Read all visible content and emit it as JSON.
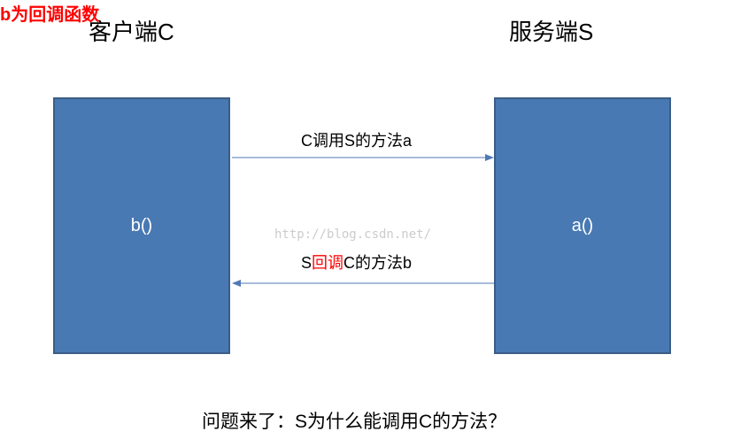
{
  "headers": {
    "client": "客户端C",
    "server": "服务端S"
  },
  "boxes": {
    "client_method": "b()",
    "server_method": "a()"
  },
  "arrows": {
    "forward_label": "C调用S的方法a",
    "callback_prefix": "S",
    "callback_red": "回调",
    "callback_suffix": "C的方法b",
    "note": "b为回调函数"
  },
  "watermark": "http://blog.csdn.net/",
  "question": "问题来了：S为什么能调用C的方法？",
  "colors": {
    "box_fill": "#4879b2",
    "box_border": "#3b5d87",
    "arrow": "#5079b5",
    "red": "#ff0000"
  }
}
